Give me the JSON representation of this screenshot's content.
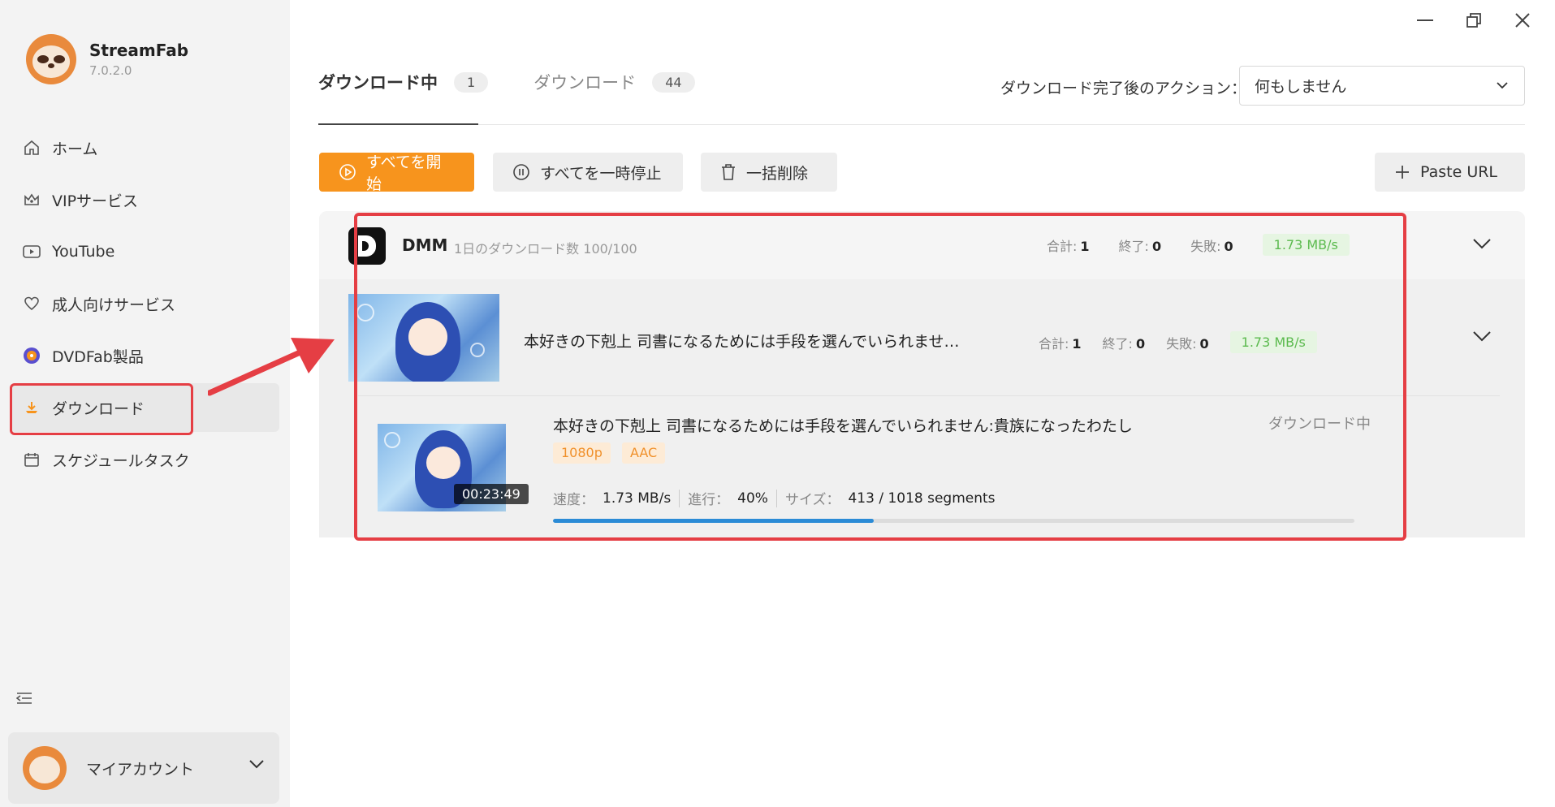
{
  "app": {
    "name": "StreamFab",
    "version": "7.0.2.0"
  },
  "sidebar": {
    "items": [
      {
        "label": "ホーム",
        "icon": "home-icon"
      },
      {
        "label": "VIPサービス",
        "icon": "crown-icon"
      },
      {
        "label": "YouTube",
        "icon": "youtube-icon"
      },
      {
        "label": "成人向けサービス",
        "icon": "heart-icon"
      },
      {
        "label": "DVDFab製品",
        "icon": "dvdfab-icon"
      },
      {
        "label": "ダウンロード",
        "icon": "download-icon",
        "active": true
      },
      {
        "label": "スケジュールタスク",
        "icon": "calendar-icon"
      }
    ],
    "account": {
      "label": "マイアカウント"
    }
  },
  "tabs": [
    {
      "label": "ダウンロード中",
      "count": "1",
      "active": true
    },
    {
      "label": "ダウンロード",
      "count": "44",
      "active": false
    }
  ],
  "action": {
    "label": "ダウンロード完了後のアクション：",
    "value": "何もしません"
  },
  "toolbar": {
    "start_all": "すべてを開始",
    "pause_all": "すべてを一時停止",
    "delete_all": "一括削除",
    "paste_url": "Paste URL"
  },
  "group": {
    "name": "DMM",
    "limit": "1日のダウンロード数 100/100",
    "total_label": "合計:",
    "total": "1",
    "done_label": "終了:",
    "done": "0",
    "failed_label": "失敗:",
    "failed": "0",
    "speed": "1.73 MB/s"
  },
  "item": {
    "title": "本好きの下剋上 司書になるためには手段を選んでいられませ…",
    "total_label": "合計:",
    "total": "1",
    "done_label": "終了:",
    "done": "0",
    "failed_label": "失敗:",
    "failed": "0",
    "speed": "1.73 MB/s"
  },
  "episode": {
    "title": "本好きの下剋上 司書になるためには手段を選んでいられません:貴族になったわたし",
    "status": "ダウンロード中",
    "tags": [
      "1080p",
      "AAC"
    ],
    "duration": "00:23:49",
    "speed_label": "速度：",
    "speed": "1.73 MB/s",
    "progress_label": "進行：",
    "progress": "40%",
    "progress_value": 40,
    "size_label": "サイズ：",
    "size": "413 / 1018 segments"
  },
  "colors": {
    "accent": "#f7941d",
    "highlight": "#e53e44",
    "progress": "#2b8bd6",
    "speed_badge": "#5bba4e"
  }
}
